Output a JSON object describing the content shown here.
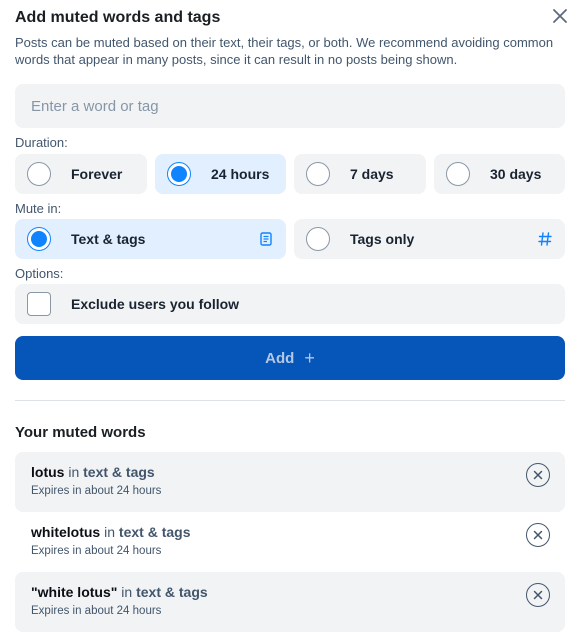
{
  "dialog": {
    "title": "Add muted words and tags",
    "description": "Posts can be muted based on their text, their tags, or both. We recommend avoiding common words that appear in many posts, since it can result in no posts being shown.",
    "close_icon": "close-icon"
  },
  "input": {
    "placeholder": "Enter a word or tag",
    "value": ""
  },
  "duration": {
    "label": "Duration:",
    "options": [
      {
        "label": "Forever",
        "selected": false
      },
      {
        "label": "24 hours",
        "selected": true
      },
      {
        "label": "7 days",
        "selected": false
      },
      {
        "label": "30 days",
        "selected": false
      }
    ]
  },
  "mute_in": {
    "label": "Mute in:",
    "options": [
      {
        "label": "Text & tags",
        "selected": true,
        "icon": "document-icon"
      },
      {
        "label": "Tags only",
        "selected": false,
        "icon": "hashtag-icon"
      }
    ]
  },
  "options": {
    "label": "Options:",
    "exclude_following": {
      "label": "Exclude users you follow",
      "checked": false
    }
  },
  "add_button": {
    "label": "Add",
    "icon": "+"
  },
  "muted": {
    "title": "Your muted words",
    "items": [
      {
        "word": "lotus",
        "in": "in",
        "mode": "text & tags",
        "expires": "Expires in about 24 hours"
      },
      {
        "word": "whitelotus",
        "in": "in",
        "mode": "text & tags",
        "expires": "Expires in about 24 hours"
      },
      {
        "word": "\"white lotus\"",
        "in": "in",
        "mode": "text & tags",
        "expires": "Expires in about 24 hours"
      }
    ]
  },
  "colors": {
    "accent": "#1083fe",
    "button": "#0656b9",
    "selected_bg": "#e1efff",
    "option_bg": "#f1f3f5"
  }
}
